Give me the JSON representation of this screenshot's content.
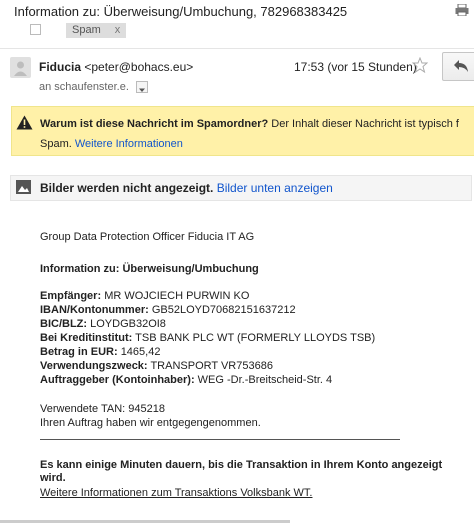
{
  "header": {
    "subject": "Information zu: Überweisung/Umbuchung, 782968383425",
    "label": "Spam",
    "label_remove": "x"
  },
  "message": {
    "sender_name": "Fiducia",
    "sender_email": "<peter@bohacs.eu>",
    "timestamp": "17:53 (vor 15 Stunden)",
    "recipient": "an schaufenster.e."
  },
  "spam_warning": {
    "title": "Warum ist diese Nachricht im Spamordner?",
    "text": "Der Inhalt dieser Nachricht ist typisch f",
    "text2": "Spam.",
    "link": "Weitere Informationen"
  },
  "images": {
    "notice": "Bilder werden nicht angezeigt.",
    "link": "Bilder unten anzeigen"
  },
  "body": {
    "org_line": "Group Data Protection Officer Fiducia IT AG",
    "heading": "Information zu: Überweisung/Umbuchung",
    "fields": [
      {
        "label": "Empfänger:",
        "value": "MR WOJCIECH PURWIN KO"
      },
      {
        "label": "IBAN/Kontonummer:",
        "value": "GB52LOYD70682151637212"
      },
      {
        "label": "BIC/BLZ:",
        "value": "LOYDGB32OI8"
      },
      {
        "label": "Bei Kreditinstitut:",
        "value": "TSB BANK PLC WT (FORMERLY LLOYDS TSB)"
      },
      {
        "label": "Betrag in EUR:",
        "value": "1465,42"
      },
      {
        "label": "Verwendungszweck:",
        "value": "TRANSPORT VR753686"
      },
      {
        "label": "Auftraggeber (Kontoinhaber):",
        "value": "WEG -Dr.-Breitscheid-Str. 4"
      }
    ],
    "tan": "Verwendete TAN: 945218",
    "confirm": "Ihren Auftrag haben wir entgegengenommen.",
    "notice_line1": "Es kann einige Minuten dauern, bis die Transaktion in Ihrem Konto angezeigt",
    "notice_line2": "wird.",
    "footer_link": "Weitere Informationen zum Transaktions Volksbank WT."
  },
  "colors": {
    "spam_bg": "#fff1a8",
    "link": "#1155cc",
    "warning_icon": "#f4c20d"
  }
}
